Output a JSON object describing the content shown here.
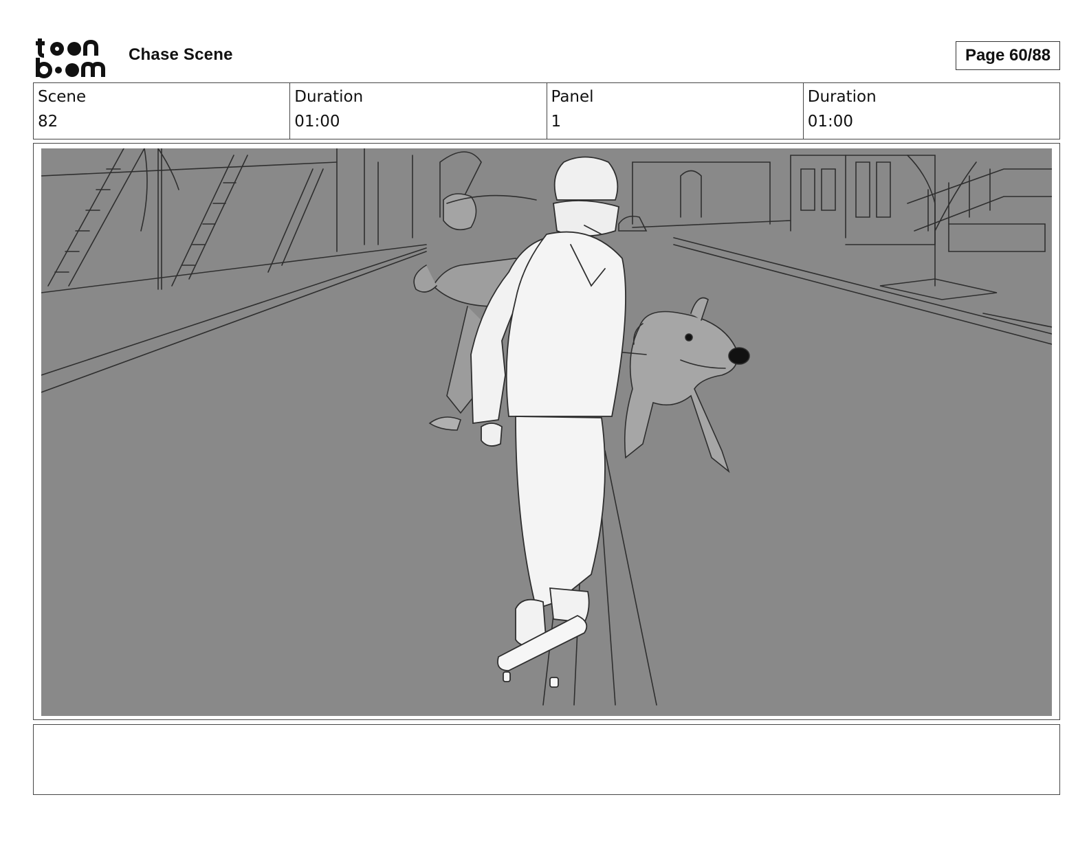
{
  "header": {
    "logo_text_top": "toon",
    "logo_text_bottom": "boom",
    "title": "Chase Scene",
    "page_label": "Page 60/88"
  },
  "info": [
    {
      "label": "Scene",
      "value": "82"
    },
    {
      "label": "Duration",
      "value": "01:00"
    },
    {
      "label": "Panel",
      "value": "1"
    },
    {
      "label": "Duration",
      "value": "01:00"
    }
  ],
  "panel": {
    "illustration": "storyboard-sketch",
    "background_color": "#898989"
  },
  "notes": {
    "text": ""
  }
}
